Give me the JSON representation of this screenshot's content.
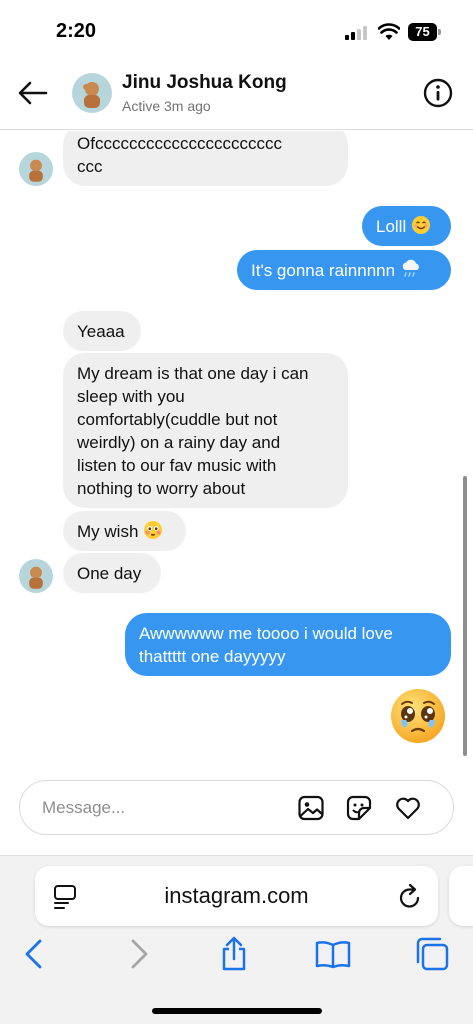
{
  "status_bar": {
    "time": "2:20",
    "battery": "75"
  },
  "header": {
    "name": "Jinu Joshua Kong",
    "status": "Active 3m ago"
  },
  "messages": [
    {
      "from": "them",
      "line1": "Ofcccccccccccccccccccccc",
      "line2": "ccc"
    },
    {
      "from": "me",
      "text": "Lolll"
    },
    {
      "from": "me",
      "text": "It's gonna rainnnnn"
    },
    {
      "from": "them",
      "text": "Yeaaa"
    },
    {
      "from": "them",
      "lines": [
        "My dream is that one day i can",
        "sleep with you",
        "comfortably(cuddle but not",
        "weirdly) on a rainy day and",
        "listen to our fav music with",
        "nothing to worry about"
      ]
    },
    {
      "from": "them",
      "text": "My wish"
    },
    {
      "from": "them",
      "text": "One day"
    },
    {
      "from": "me",
      "line1": "Awwwwww me toooo i would love",
      "line2": "thattttt one dayyyyy"
    },
    {
      "from": "me",
      "emoji": "pleading-face-with-tear"
    }
  ],
  "composer": {
    "placeholder": "Message..."
  },
  "browser": {
    "url": "instagram.com"
  },
  "icons": {
    "back": "back-arrow-icon",
    "info": "info-icon",
    "gallery": "image-icon",
    "sticker": "sticker-icon",
    "like": "heart-icon",
    "reader": "reader-icon",
    "reload": "reload-icon",
    "nav_back": "chevron-left-icon",
    "nav_forward": "chevron-right-icon",
    "share": "share-icon",
    "bookmarks": "book-icon",
    "tabs": "tabs-icon"
  },
  "colors": {
    "outgoing": "#3797f0",
    "incoming": "#efefef",
    "safari_blue": "#1a73e8"
  }
}
